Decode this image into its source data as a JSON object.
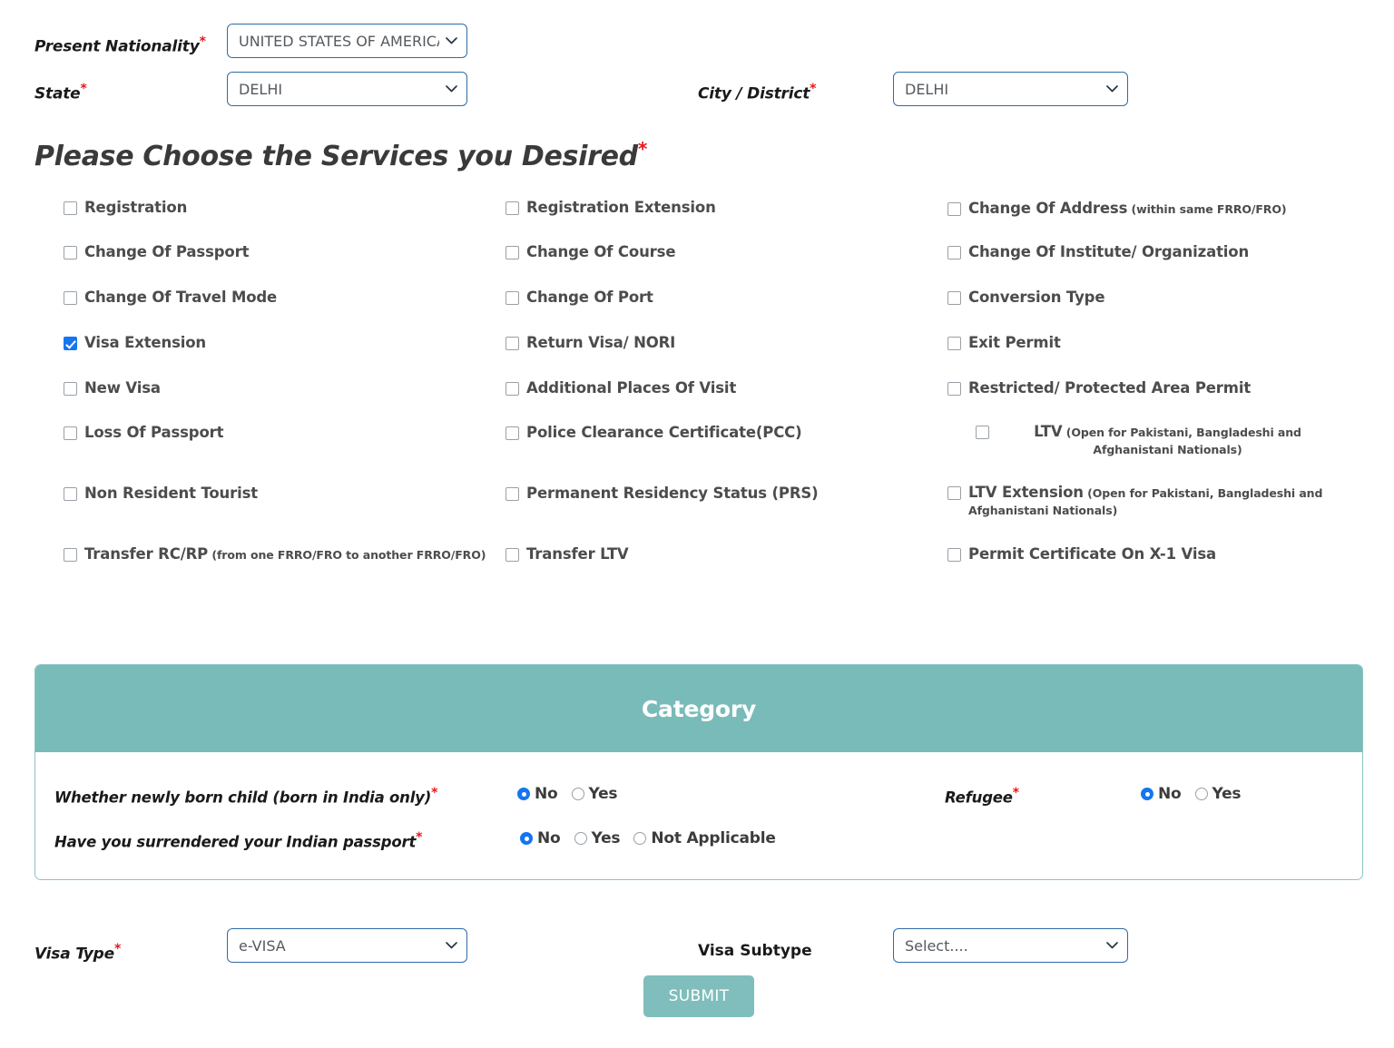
{
  "top_form": {
    "nationality": {
      "label": "Present Nationality",
      "required": true,
      "value": "UNITED STATES OF AMERICA"
    },
    "state": {
      "label": "State",
      "required": true,
      "value": "DELHI"
    },
    "city": {
      "label": "City / District",
      "required": true,
      "value": "DELHI"
    }
  },
  "services": {
    "heading": "Please Choose the Services you Desired",
    "heading_required": "*",
    "items": [
      {
        "label": "Registration",
        "note": "",
        "checked": false,
        "col": 0,
        "row": 0
      },
      {
        "label": "Registration Extension",
        "note": "",
        "checked": false,
        "col": 1,
        "row": 0
      },
      {
        "label": "Change Of Address",
        "note": "(within same FRRO/FRO)",
        "checked": false,
        "col": 2,
        "row": 0
      },
      {
        "label": "Change Of Passport",
        "note": "",
        "checked": false,
        "col": 0,
        "row": 1
      },
      {
        "label": "Change Of Course",
        "note": "",
        "checked": false,
        "col": 1,
        "row": 1
      },
      {
        "label": "Change Of Institute/ Organization",
        "note": "",
        "checked": false,
        "col": 2,
        "row": 1
      },
      {
        "label": "Change Of Travel Mode",
        "note": "",
        "checked": false,
        "col": 0,
        "row": 2
      },
      {
        "label": "Change Of Port",
        "note": "",
        "checked": false,
        "col": 1,
        "row": 2
      },
      {
        "label": "Conversion Type",
        "note": "",
        "checked": false,
        "col": 2,
        "row": 2
      },
      {
        "label": "Visa Extension",
        "note": "",
        "checked": true,
        "col": 0,
        "row": 3
      },
      {
        "label": "Return Visa/ NORI",
        "note": "",
        "checked": false,
        "col": 1,
        "row": 3
      },
      {
        "label": "Exit Permit",
        "note": "",
        "checked": false,
        "col": 2,
        "row": 3
      },
      {
        "label": "New Visa",
        "note": "",
        "checked": false,
        "col": 0,
        "row": 4
      },
      {
        "label": "Additional Places Of Visit",
        "note": "",
        "checked": false,
        "col": 1,
        "row": 4
      },
      {
        "label": "Restricted/ Protected Area Permit",
        "note": "",
        "checked": false,
        "col": 2,
        "row": 4
      },
      {
        "label": "Loss Of Passport",
        "note": "",
        "checked": false,
        "col": 0,
        "row": 5
      },
      {
        "label": "Police Clearance Certificate(PCC)",
        "note": "",
        "checked": false,
        "col": 1,
        "row": 5
      },
      {
        "label": "LTV",
        "note": "(Open for Pakistani, Bangladeshi and Afghanistani Nationals)",
        "checked": false,
        "col": 2,
        "row": 5
      },
      {
        "label": "Non Resident Tourist",
        "note": "",
        "checked": false,
        "col": 0,
        "row": 6
      },
      {
        "label": "Permanent Residency Status (PRS)",
        "note": "",
        "checked": false,
        "col": 1,
        "row": 6
      },
      {
        "label": "LTV Extension",
        "note": "(Open for Pakistani, Bangladeshi and Afghanistani Nationals)",
        "checked": false,
        "col": 2,
        "row": 6
      },
      {
        "label": "Transfer RC/RP",
        "note": "(from one FRRO/FRO to another FRRO/FRO)",
        "checked": false,
        "col": 0,
        "row": 7
      },
      {
        "label": "Transfer LTV",
        "note": "",
        "checked": false,
        "col": 1,
        "row": 7
      },
      {
        "label": "Permit Certificate On X-1 Visa",
        "note": "",
        "checked": false,
        "col": 2,
        "row": 7
      }
    ]
  },
  "category": {
    "title": "Category",
    "newborn": {
      "label": "Whether newly born child  (born in India only)",
      "required": "*",
      "options": [
        "No",
        "Yes"
      ],
      "selected": "No"
    },
    "surrendered": {
      "label": "Have you surrendered your Indian passport",
      "required": "*",
      "options": [
        "No",
        "Yes",
        "Not Applicable"
      ],
      "selected": "No"
    },
    "refugee": {
      "label": "Refugee",
      "required": "*",
      "options": [
        "No",
        "Yes"
      ],
      "selected": "No"
    }
  },
  "bottom": {
    "visa_type": {
      "label": "Visa Type",
      "required": "*",
      "value": "e-VISA"
    },
    "visa_subtype": {
      "label": "Visa Subtype",
      "required": "",
      "value": "Select...."
    },
    "submit_label": "SUBMIT"
  },
  "colors": {
    "teal": "#79bbb9",
    "teal_button": "#7fbebc",
    "required_red": "#e8161c",
    "select_border": "#2f6ba5",
    "checkbox_checked": "#1675ef"
  }
}
